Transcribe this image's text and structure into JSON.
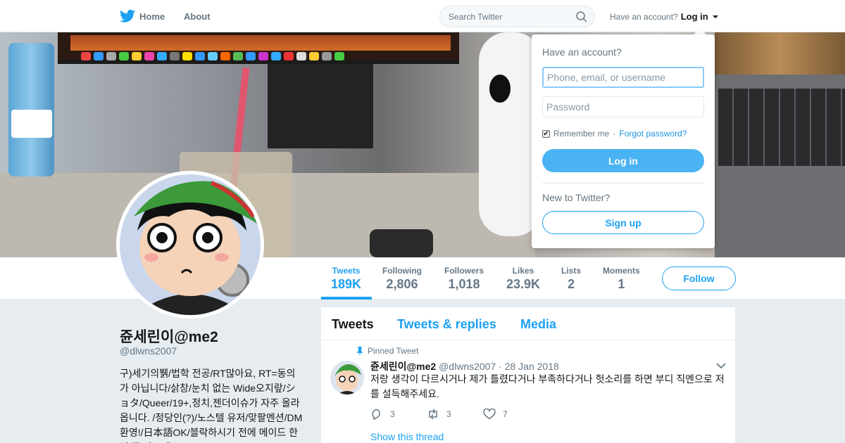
{
  "nav": {
    "home_label": "Home",
    "about_label": "About",
    "search_placeholder": "Search Twitter",
    "have_account": "Have an account?",
    "login_label": "Log in"
  },
  "profile": {
    "name": "쥰세린이@me2",
    "handle": "@dlwns2007",
    "bio": "구)세기의뷁/법학 전공/RT많아요, RT=동의 가 아닙니다/삵창/눈치 없는 Wide오지랖/ショタ/Queer/19+,정치,젠더이슈가 자주 올라옵니다. /정당인(?)/노스텔 유저/맞팔멘션/DM환영!/日本語OK/블락하시기 전에 메이드 한 번 꼭 봐주세요."
  },
  "stats": [
    {
      "label": "Tweets",
      "value": "189K"
    },
    {
      "label": "Following",
      "value": "2,806"
    },
    {
      "label": "Followers",
      "value": "1,018"
    },
    {
      "label": "Likes",
      "value": "23.9K"
    },
    {
      "label": "Lists",
      "value": "2"
    },
    {
      "label": "Moments",
      "value": "1"
    }
  ],
  "follow_label": "Follow",
  "timeline": {
    "tabs": [
      "Tweets",
      "Tweets & replies",
      "Media"
    ],
    "pinned_label": "Pinned Tweet",
    "tweet": {
      "name": "쥰세린이@me2",
      "handle": "@dlwns2007",
      "separator": "·",
      "date": "28 Jan 2018",
      "text": "저랑 생각이 다르시거나 제가 틀렸다거나 부족하다거나 헛소리를 하면 부디 직멘으로 저를 설득해주세요.",
      "replies": "3",
      "retweets": "3",
      "likes": "7"
    },
    "show_thread": "Show this thread"
  },
  "login_dropdown": {
    "title": "Have an account?",
    "username_placeholder": "Phone, email, or username",
    "password_placeholder": "Password",
    "remember_label": "Remember me",
    "separator": "·",
    "forgot_label": "Forgot password?",
    "login_button": "Log in",
    "new_label": "New to Twitter?",
    "signup_button": "Sign up"
  },
  "colors": {
    "accent": "#1da1f2",
    "login_button": "#4ab3f4",
    "background": "#e6ecf0"
  }
}
